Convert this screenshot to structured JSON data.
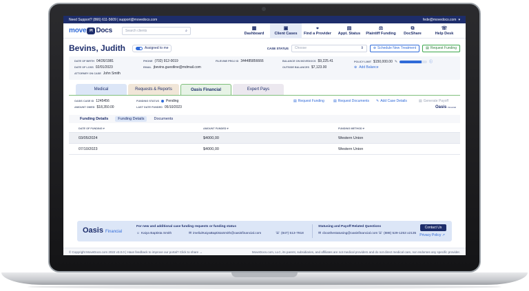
{
  "topbar": {
    "support": "Need Support? (866) 611-5609 | support@movedocs.com",
    "user": "fede@movedocs.com"
  },
  "nav": {
    "logo_left": "move",
    "logo_mid": "PI",
    "logo_right": "Docs",
    "search_placeholder": "Search clients",
    "items": [
      {
        "label": "Dashboard",
        "icon": "▦"
      },
      {
        "label": "Client Cases",
        "icon": "▣"
      },
      {
        "label": "Find a Provider",
        "icon": "⌖"
      },
      {
        "label": "Appt. Status",
        "icon": "▤"
      },
      {
        "label": "Plaintiff Funding",
        "icon": "⚖"
      },
      {
        "label": "DocShare",
        "icon": "⧉"
      },
      {
        "label": "Help Desk",
        "icon": "☏"
      }
    ]
  },
  "patient": {
    "name": "Bevins, Judith",
    "assigned_label": "Assigned to me",
    "case_status_label": "CASE STATUS",
    "case_status_placeholder": "Choose",
    "schedule_label": "Schedule New Treatment",
    "request_funding_label": "Request Funding"
  },
  "info": {
    "dob_label": "DATE OF BIRTH",
    "dob": "04/26/1981",
    "dol_label": "DATE OF LOSS",
    "dol": "02/01/2023",
    "attorney_label": "ATTORNEY ON CASE",
    "attorney": "John Smith",
    "phone_label": "PHONE",
    "phone": "(702) 912-0019",
    "email_label": "EMAIL",
    "email": "jbevins.guestline@mdmail.com",
    "proj_label": "FILEVINE PROJ ID",
    "proj": "344485856666",
    "balance_label": "BALANCE ON MOVEDOCS",
    "balance": "$9,225.41",
    "outside_label": "OUTSIDE BALANCES",
    "outside": "$7,123.00",
    "limit_label": "POLICY LIMIT",
    "limit": "$150,000.00",
    "limit_fraction": 0.8,
    "add_balance": "Add Balance"
  },
  "tabs": [
    "Medical",
    "Requests & Reports",
    "Oasis Financial",
    "Expert Pays"
  ],
  "oasis": {
    "case_id_label": "OASIS CASE ID",
    "case_id": "1245456",
    "amount_owed_label": "AMOUNT OWED",
    "amount_owed": "$18,350.00",
    "funding_status_label": "FUNDING STATUS",
    "funding_status": "Pending",
    "last_funded_label": "LAST DATE FUNDED",
    "last_funded": "05/10/2023",
    "actions": [
      "Request Funding",
      "Request Documents",
      "Add Case Details",
      "Generate Payoff"
    ],
    "brand": "Oasis",
    "brand_sub": "Financial"
  },
  "subtabs": {
    "title": "Funding Details",
    "items": [
      "Funding Details",
      "Documents"
    ]
  },
  "table": {
    "headers": [
      "DATE OF FUNDING",
      "AMOUNT FUNDED",
      "FUNDING METHOD"
    ],
    "rows": [
      [
        "03/05/2024",
        "$4000,00",
        "Western Union"
      ],
      [
        "07/10/2023",
        "$4000,00",
        "Western Union"
      ]
    ]
  },
  "banner": {
    "logo": "Oasis",
    "logo_sub": "Financial",
    "left_title": "For new and additional case funding requests or funding status",
    "contact_name": "Kaiya Baptista Smith",
    "contact_email": "imeliulKaiyaBaptistaSmith@oasisfinancial.com",
    "contact_phone": "(847) 513-7918",
    "right_title": "Statusing and Payoff Related Questions",
    "status_email": "cboothestatusing@oasisfinancial.com",
    "status_phone": "(888) 529-1253 x2135",
    "contact_button": "Contact Us",
    "privacy": "Privacy Policy"
  },
  "footer": {
    "left": "© Copyright MoveDocs.com 2022 v3.0.0 | Have feedback to improve our portal? Click to share →",
    "right": "MoveDocs.com, LLC, its parent, subsidiaries, and affiliates are not medical providers and do not direct medical care, nor endorses any specific provider."
  },
  "colors": {
    "primary": "#1d2d6b",
    "accent": "#2f6ad8",
    "success": "#3aa64a"
  }
}
